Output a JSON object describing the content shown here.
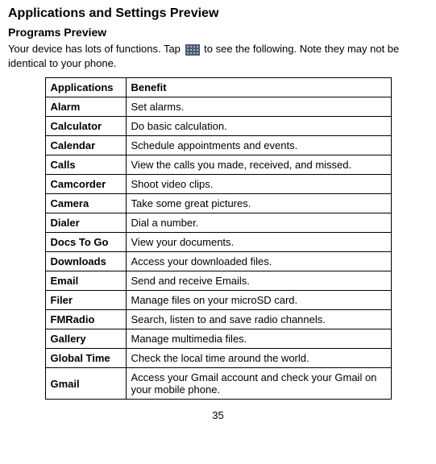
{
  "headings": {
    "title": "Applications and Settings Preview",
    "subtitle": "Programs Preview"
  },
  "intro": {
    "part1": "Your device has lots of functions. Tap ",
    "part2": " to see the following. ",
    "part3": "Note they may not be identical to your phone."
  },
  "icon_name": "apps-grid-icon",
  "table": {
    "headers": {
      "col1": "Applications",
      "col2": "Benefit"
    },
    "rows": [
      {
        "app": "Alarm",
        "benefit": "Set alarms."
      },
      {
        "app": "Calculator",
        "benefit": "Do basic calculation."
      },
      {
        "app": "Calendar",
        "benefit": "Schedule appointments and events."
      },
      {
        "app": "Calls",
        "benefit": "View the calls you made, received, and missed."
      },
      {
        "app": "Camcorder",
        "benefit": "Shoot video clips."
      },
      {
        "app": "Camera",
        "benefit": "Take some great pictures."
      },
      {
        "app": "Dialer",
        "benefit": "Dial a number."
      },
      {
        "app": "Docs To Go",
        "benefit": "View your documents."
      },
      {
        "app": "Downloads",
        "benefit": "Access your downloaded files."
      },
      {
        "app": "Email",
        "benefit": "Send and receive Emails."
      },
      {
        "app": "Filer",
        "benefit": "Manage files on your microSD card."
      },
      {
        "app": "FMRadio",
        "benefit": "Search, listen to and save radio channels."
      },
      {
        "app": "Gallery",
        "benefit": "Manage multimedia files."
      },
      {
        "app": "Global Time",
        "benefit": "Check the local time around the world."
      },
      {
        "app": "Gmail",
        "benefit": "Access your Gmail account and check your Gmail on your mobile phone."
      }
    ]
  },
  "page_number": "35"
}
